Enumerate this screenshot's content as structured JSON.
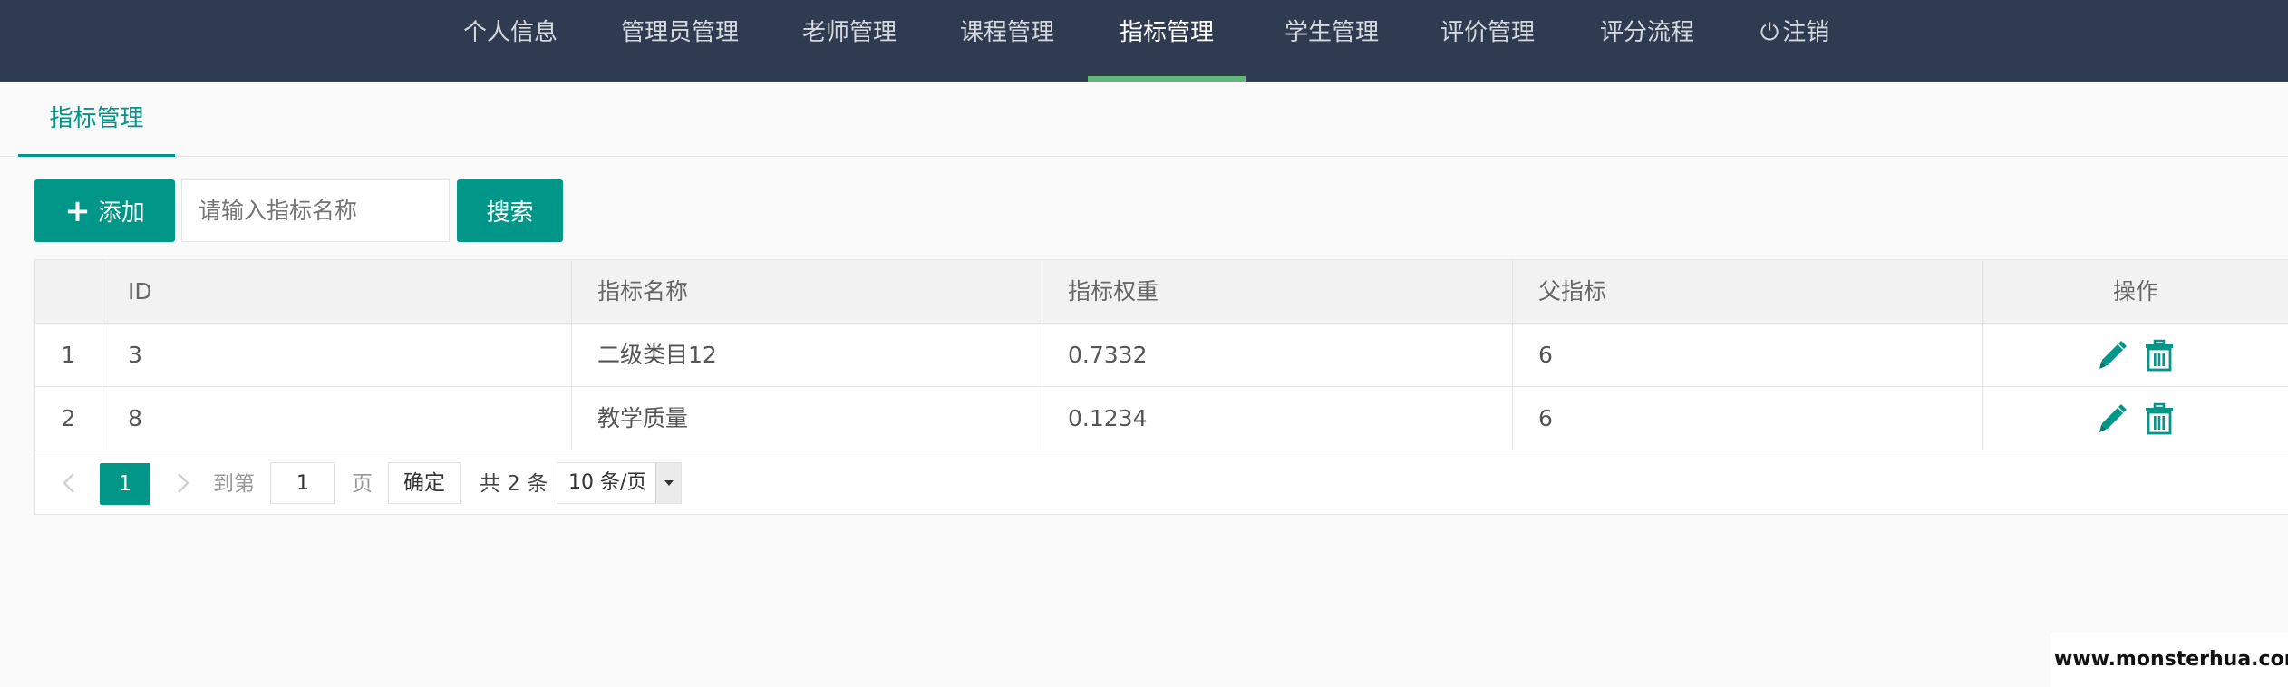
{
  "nav": {
    "items": [
      {
        "label": "个人信息"
      },
      {
        "label": "管理员管理"
      },
      {
        "label": "老师管理"
      },
      {
        "label": "课程管理"
      },
      {
        "label": "指标管理",
        "active": true
      },
      {
        "label": "学生管理"
      },
      {
        "label": "评价管理"
      },
      {
        "label": "评分流程"
      },
      {
        "label": "注销",
        "icon": "power-icon"
      }
    ]
  },
  "tab": {
    "label": "指标管理"
  },
  "toolbar": {
    "add_label": "添加",
    "search_placeholder": "请输入指标名称",
    "search_label": "搜索"
  },
  "table": {
    "headers": {
      "index": "",
      "id": "ID",
      "name": "指标名称",
      "weight": "指标权重",
      "parent": "父指标",
      "ops": "操作"
    },
    "rows": [
      {
        "index": "1",
        "id": "3",
        "name": "二级类目12",
        "weight": "0.7332",
        "parent": "6"
      },
      {
        "index": "2",
        "id": "8",
        "name": "教学质量",
        "weight": "0.1234",
        "parent": "6"
      }
    ],
    "row_actions": [
      "edit-icon",
      "trash-icon"
    ]
  },
  "pager": {
    "current_page": "1",
    "goto_label": "到第",
    "goto_value": "1",
    "page_unit": "页",
    "confirm_label": "确定",
    "total_label": "共 2 条",
    "page_size_label": "10 条/页"
  },
  "watermark": {
    "text": "www.monsterhua.com"
  },
  "colors": {
    "nav_bg": "#2f3b50",
    "accent": "#009688",
    "nav_active_bar": "#5fb878"
  }
}
